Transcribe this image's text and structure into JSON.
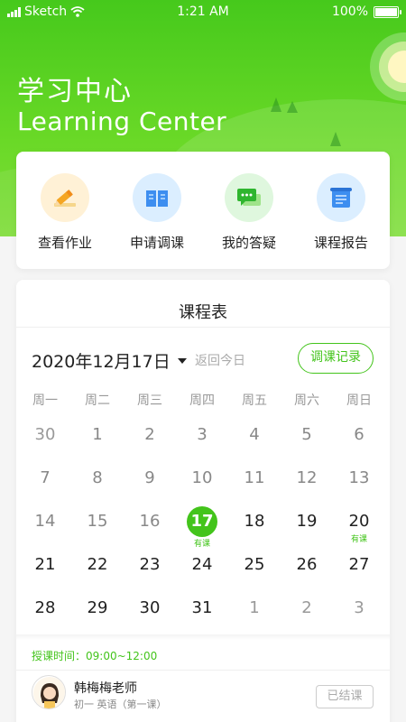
{
  "status_bar": {
    "carrier": "Sketch",
    "time": "1:21 AM",
    "battery": "100%"
  },
  "header": {
    "title_cn": "学习中心",
    "title_en": "Learning Center"
  },
  "quick_actions": [
    {
      "label": "查看作业",
      "icon": "pencil-icon"
    },
    {
      "label": "申请调课",
      "icon": "book-icon"
    },
    {
      "label": "我的答疑",
      "icon": "chat-icon"
    },
    {
      "label": "课程报告",
      "icon": "report-scroll-icon"
    }
  ],
  "schedule": {
    "title": "课程表",
    "selected_date": "2020年12月17日",
    "back_today": "返回今日",
    "record_button": "调课记录",
    "weekdays": [
      "周一",
      "周二",
      "周三",
      "周四",
      "周五",
      "周六",
      "周日"
    ],
    "weeks": [
      [
        {
          "d": "30",
          "s": "other"
        },
        {
          "d": "1",
          "s": "past"
        },
        {
          "d": "2",
          "s": "past"
        },
        {
          "d": "3",
          "s": "past"
        },
        {
          "d": "4",
          "s": "past"
        },
        {
          "d": "5",
          "s": "past"
        },
        {
          "d": "6",
          "s": "past"
        }
      ],
      [
        {
          "d": "7",
          "s": "past"
        },
        {
          "d": "8",
          "s": "past"
        },
        {
          "d": "9",
          "s": "past"
        },
        {
          "d": "10",
          "s": "past"
        },
        {
          "d": "11",
          "s": "past"
        },
        {
          "d": "12",
          "s": "past"
        },
        {
          "d": "13",
          "s": "past"
        }
      ],
      [
        {
          "d": "14",
          "s": "past"
        },
        {
          "d": "15",
          "s": "past"
        },
        {
          "d": "16",
          "s": "past"
        },
        {
          "d": "17",
          "s": "selected",
          "tag": "有课"
        },
        {
          "d": "18",
          "s": "future"
        },
        {
          "d": "19",
          "s": "future"
        },
        {
          "d": "20",
          "s": "future",
          "tag": "有课"
        }
      ],
      [
        {
          "d": "21",
          "s": "future"
        },
        {
          "d": "22",
          "s": "future"
        },
        {
          "d": "23",
          "s": "future"
        },
        {
          "d": "24",
          "s": "future"
        },
        {
          "d": "25",
          "s": "future"
        },
        {
          "d": "26",
          "s": "future"
        },
        {
          "d": "27",
          "s": "future"
        }
      ],
      [
        {
          "d": "28",
          "s": "future"
        },
        {
          "d": "29",
          "s": "future"
        },
        {
          "d": "30",
          "s": "future"
        },
        {
          "d": "31",
          "s": "future"
        },
        {
          "d": "1",
          "s": "other"
        },
        {
          "d": "2",
          "s": "other"
        },
        {
          "d": "3",
          "s": "other"
        }
      ]
    ]
  },
  "lesson": {
    "time": "授课时间：09:00~12:00",
    "teacher": "韩梅梅老师",
    "course": "初一 英语（第一课）",
    "status": "已结课"
  },
  "colors": {
    "accent": "#43c41b"
  }
}
